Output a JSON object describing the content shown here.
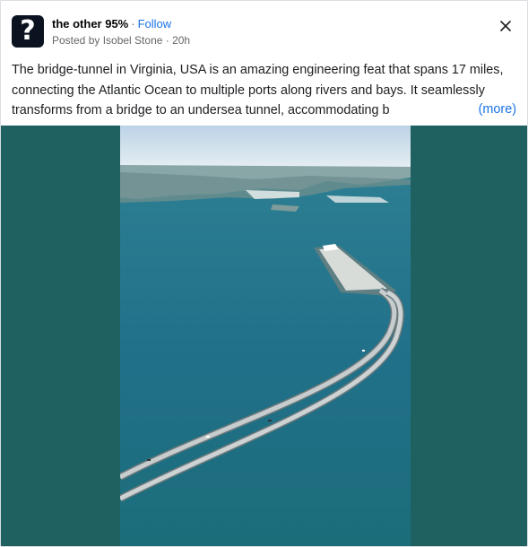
{
  "post": {
    "group_name": "the other 95%",
    "separator": "·",
    "follow_label": "Follow",
    "posted_by": "Posted by Isobel Stone · 20h",
    "text": "The bridge-tunnel in Virginia, USA is an amazing engineering feat that spans 17 miles, connecting the Atlantic Ocean to multiple ports along rivers and bays. It seamlessly transforms from a bridge to an undersea tunnel, accommodating b",
    "more_label": "(more)"
  },
  "avatar": {
    "glyph": "?"
  },
  "icons": {
    "close": "close-icon"
  },
  "colors": {
    "link": "#1a73e8",
    "media_background": "#1f6060",
    "water": "#1f6e7e",
    "sky": "#c9dbe8"
  }
}
